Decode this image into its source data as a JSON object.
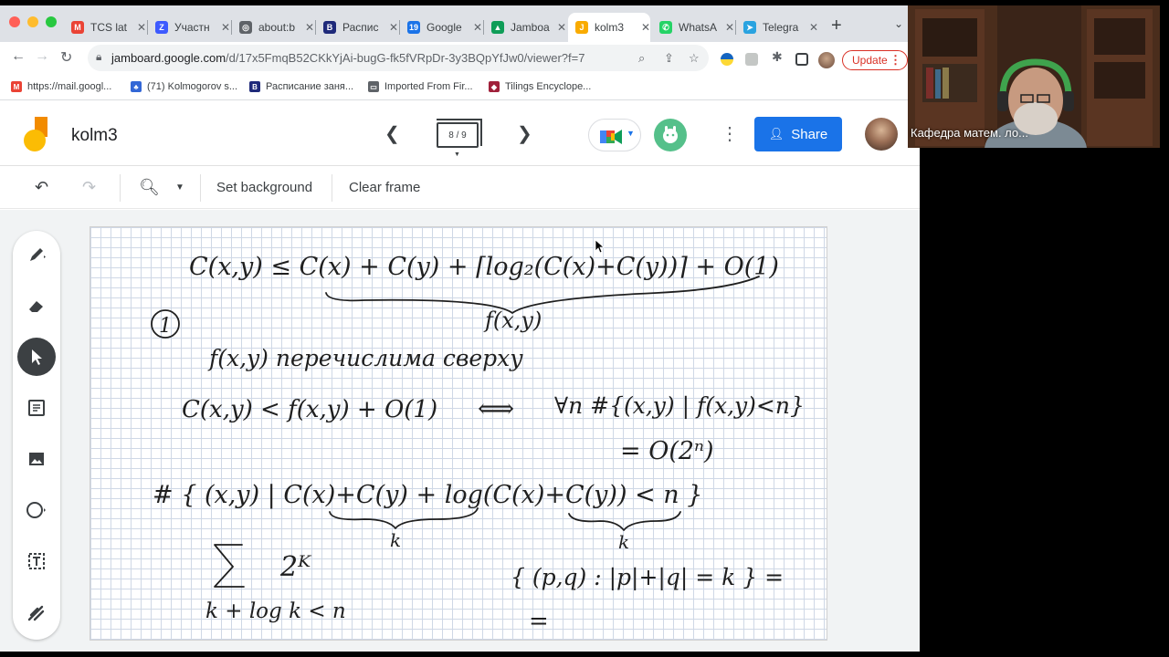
{
  "browser": {
    "tabs": [
      {
        "title": "TCS lat",
        "icon": "gmail-icon",
        "color": "#ea4335",
        "glyph": "M"
      },
      {
        "title": "Участн",
        "icon": "zoom-icon",
        "color": "#3d5afe",
        "glyph": "Z"
      },
      {
        "title": "about:b",
        "icon": "globe-icon",
        "color": "#5f6368",
        "glyph": "◎"
      },
      {
        "title": "Распис",
        "icon": "hse-icon",
        "color": "#1f2a7a",
        "glyph": "B"
      },
      {
        "title": "Google",
        "icon": "calendar-icon",
        "color": "#1a73e8",
        "glyph": "19"
      },
      {
        "title": "Jamboa",
        "icon": "drive-icon",
        "color": "#0f9d58",
        "glyph": "▲"
      },
      {
        "title": "kolm3",
        "icon": "jamboard-icon",
        "color": "#f9ab00",
        "glyph": "J"
      },
      {
        "title": "WhatsA",
        "icon": "whatsapp-icon",
        "color": "#25d366",
        "glyph": "✆"
      },
      {
        "title": "Telegra",
        "icon": "telegram-icon",
        "color": "#2aa3e0",
        "glyph": "➤"
      }
    ],
    "new_tab": "+",
    "url_host": "jamboard.google.com",
    "url_path": "/d/17x5FmqB52CKkYjAi-bugG-fk5fVRpDr-3y3BQpYfJw0/viewer?f=7",
    "update_label": "Update",
    "bookmarks": [
      {
        "label": "https://mail.googl...",
        "icon": "gmail-icon",
        "color": "#ea4335",
        "glyph": "M"
      },
      {
        "label": "(71) Kolmogorov s...",
        "icon": "people-icon",
        "color": "#3367d6",
        "glyph": "♣"
      },
      {
        "label": "Расписание заня...",
        "icon": "hse-icon",
        "color": "#1f2a7a",
        "glyph": "B"
      },
      {
        "label": "Imported From Fir...",
        "icon": "folder-icon",
        "color": "#5f6368",
        "glyph": "▭"
      },
      {
        "label": "Tilings Encyclope...",
        "icon": "tiling-icon",
        "color": "#a0203a",
        "glyph": "◆"
      }
    ]
  },
  "jamboard": {
    "title": "kolm3",
    "frame_counter": "8 / 9",
    "share_label": "Share",
    "toolbar": {
      "set_background": "Set background",
      "clear_frame": "Clear frame"
    }
  },
  "video": {
    "participant_name": "Кафедра матем. ло..."
  },
  "whiteboard": {
    "line1": "C(x,y) ≤ C(x) + C(y) + ⌈log₂(C(x)+C(y))⌉ + O(1)",
    "line1_brace_label": "f(x,y)",
    "circled": "1",
    "line2": "f(x,y) перечислима сверху",
    "line3_left": "C(x,y) < f(x,y) + O(1)",
    "line3_arrow": "⟺",
    "line3_right": "∀n #{(x,y) | f(x,y)<n}",
    "line4": "= O(2ⁿ)",
    "line5": "# { (x,y) | C(x)+C(y) + log(C(x)+C(y)) < n }",
    "line5_label_k1": "k",
    "line5_label_k2": "k",
    "sum_term": "2ᴷ",
    "sum_sub": "k + log k < n",
    "set_expr": "{ (p,q) : |p|+|q| = k } =",
    "eq_sign": "="
  }
}
